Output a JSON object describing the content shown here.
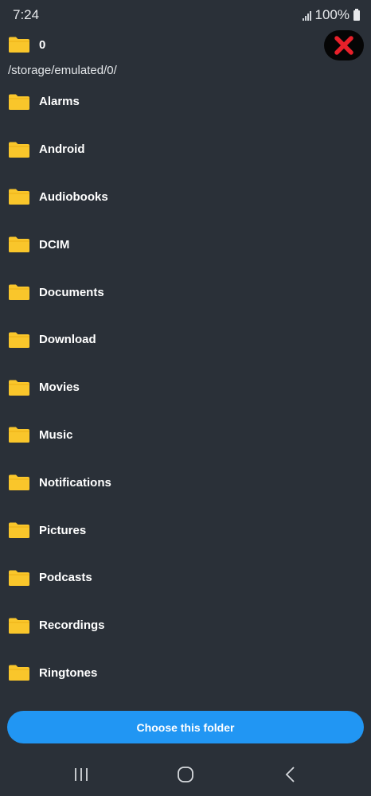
{
  "status_bar": {
    "time": "7:24",
    "battery": "100%"
  },
  "header": {
    "current_folder": "0",
    "path": "/storage/emulated/0/"
  },
  "folders": [
    {
      "label": "Alarms"
    },
    {
      "label": "Android"
    },
    {
      "label": "Audiobooks"
    },
    {
      "label": "DCIM"
    },
    {
      "label": "Documents"
    },
    {
      "label": "Download"
    },
    {
      "label": "Movies"
    },
    {
      "label": "Music"
    },
    {
      "label": "Notifications"
    },
    {
      "label": "Pictures"
    },
    {
      "label": "Podcasts"
    },
    {
      "label": "Recordings"
    },
    {
      "label": "Ringtones"
    }
  ],
  "actions": {
    "choose_label": "Choose this folder"
  },
  "colors": {
    "background": "#2a3038",
    "folder": "#f9c62b",
    "accent": "#2196f3",
    "close": "#e8202a"
  },
  "icons": {
    "folder": "folder-icon",
    "close": "close-icon",
    "signal": "signal-icon",
    "battery": "battery-icon",
    "nav_recents": "recents-icon",
    "nav_home": "home-icon",
    "nav_back": "back-icon"
  }
}
